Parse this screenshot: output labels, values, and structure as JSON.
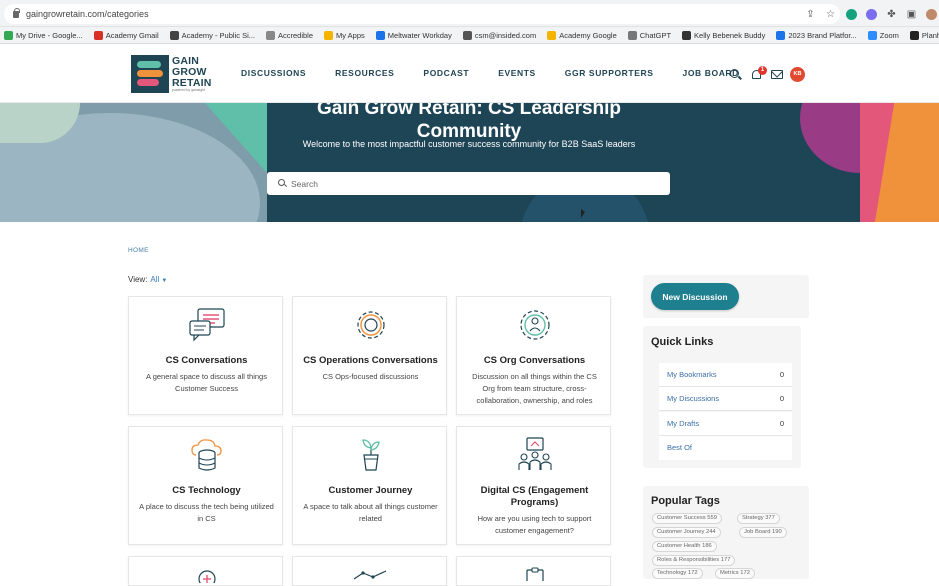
{
  "browser": {
    "url": "gaingrowretain.com/categories",
    "bookmarks": [
      {
        "label": "My Drive - Google...",
        "color": "#34a853"
      },
      {
        "label": "Academy Gmail",
        "color": "#d93025"
      },
      {
        "label": "Academy - Public Si...",
        "color": "#444444"
      },
      {
        "label": "Accredible",
        "color": "#888888"
      },
      {
        "label": "My Apps",
        "color": "#f4b400"
      },
      {
        "label": "Meltwater Workday",
        "color": "#1a73e8"
      },
      {
        "label": "csm@insided.com",
        "color": "#555555"
      },
      {
        "label": "Academy Google",
        "color": "#f4b400"
      },
      {
        "label": "ChatGPT",
        "color": "#777777"
      },
      {
        "label": "Kelly Bebenek Buddy",
        "color": "#333333"
      },
      {
        "label": "2023 Brand Platfor...",
        "color": "#1a73e8"
      },
      {
        "label": "Zoom",
        "color": "#2d8cff"
      },
      {
        "label": "Planhat Report",
        "color": "#222222"
      }
    ]
  },
  "header": {
    "logo_line1": "GAIN",
    "logo_line2": "GROW",
    "logo_line3": "RETAIN",
    "logo_sub": "powered by gainsight",
    "nav": [
      "DISCUSSIONS",
      "RESOURCES",
      "PODCAST",
      "EVENTS",
      "GGR SUPPORTERS",
      "JOB BOARD"
    ],
    "notification_count": "1",
    "avatar_initials": "KB"
  },
  "hero": {
    "title_line1": "Gain Grow Retain: CS Leadership",
    "title_line2": "Community",
    "subtitle": "Welcome to the most impactful customer success community for B2B SaaS leaders",
    "search_placeholder": "Search"
  },
  "breadcrumb": "HOME",
  "view": {
    "label": "View:",
    "value": "All"
  },
  "categories": [
    {
      "title": "CS Conversations",
      "desc": "A general space to discuss all things Customer Success",
      "icon": "chat-bubbles-icon"
    },
    {
      "title": "CS Operations Conversations",
      "desc": "CS Ops-focused discussions",
      "icon": "gear-icon"
    },
    {
      "title": "CS Org Conversations",
      "desc": "Discussion on all things within the CS Org from team structure, cross-collaboration, ownership, and roles",
      "icon": "org-gear-icon"
    },
    {
      "title": "CS Technology",
      "desc": "A place to discuss the tech being utilized in CS",
      "icon": "cloud-database-icon"
    },
    {
      "title": "Customer Journey",
      "desc": "A space to talk about all things customer related",
      "icon": "plant-icon"
    },
    {
      "title": "Digital CS (Engagement Programs)",
      "desc": "How are you using tech to support customer engagement?",
      "icon": "people-screen-icon"
    }
  ],
  "sidebar": {
    "new_discussion": "New Discussion",
    "quick_links_title": "Quick Links",
    "quick_links": [
      {
        "label": "My Bookmarks",
        "count": "0"
      },
      {
        "label": "My Discussions",
        "count": "0"
      },
      {
        "label": "My Drafts",
        "count": "0"
      },
      {
        "label": "Best Of",
        "count": ""
      }
    ],
    "popular_tags_title": "Popular Tags",
    "tags": [
      "Customer Success 559",
      "Strategy 377",
      "Customer Journey 244",
      "Job Board 190",
      "Customer Health 186",
      "Roles & Responsibilities 177",
      "Technology 172",
      "Metrics 172"
    ]
  },
  "colors": {
    "brand_dark": "#1f4454",
    "teal": "#1e7f8e",
    "link": "#3a6fa8"
  }
}
